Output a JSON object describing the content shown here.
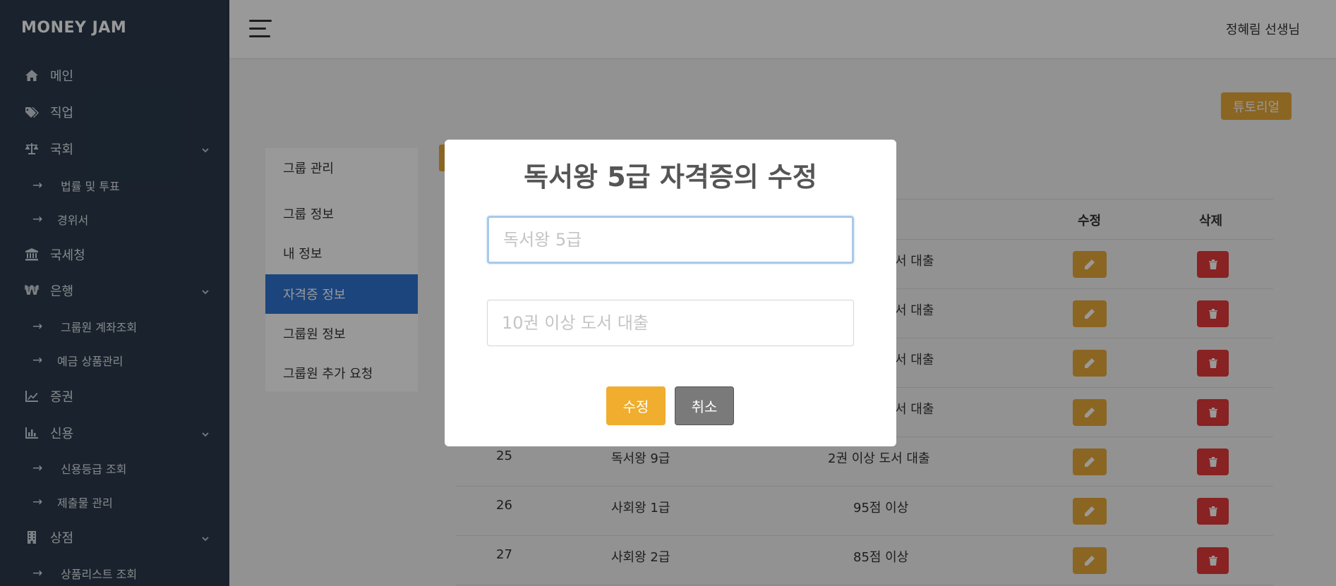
{
  "brand": "MONEY JAM",
  "sidebar": {
    "items": [
      {
        "label": "메인",
        "icon": "home-icon"
      },
      {
        "label": "직업",
        "icon": "tags-icon"
      },
      {
        "label": "국회",
        "icon": "balance-scale-icon",
        "expandable": true
      },
      {
        "label": "법률 및 투표",
        "sub": true
      },
      {
        "label": "경위서",
        "sub": true
      },
      {
        "label": "국세청",
        "icon": "bank-icon"
      },
      {
        "label": "은행",
        "icon": "won-icon",
        "expandable": true
      },
      {
        "label": "그룹원 계좌조회",
        "sub": true
      },
      {
        "label": "예금 상품관리",
        "sub": true
      },
      {
        "label": "증권",
        "icon": "line-chart-icon"
      },
      {
        "label": "신용",
        "icon": "bar-chart-icon",
        "expandable": true
      },
      {
        "label": "신용등급 조회",
        "sub": true
      },
      {
        "label": "제출물 관리",
        "sub": true
      },
      {
        "label": "상점",
        "icon": "building-icon",
        "expandable": true
      },
      {
        "label": "상품리스트 조회",
        "sub": true
      }
    ],
    "arrow": "→"
  },
  "topbar": {
    "user": "정혜림 선생님",
    "tutorial": "튜토리얼"
  },
  "submenu": {
    "header": "그룹 관리",
    "items": [
      "그룹 정보",
      "내 정보",
      "자격증 정보",
      "그룹원 정보",
      "그룹원 추가 요청"
    ],
    "active": "자격증 정보"
  },
  "table": {
    "headers": {
      "edit": "수정",
      "delete": "삭제"
    },
    "partial_rows": [
      "서 대출",
      "서 대출",
      "서 대출",
      "서 대출"
    ],
    "rows": [
      {
        "id": "25",
        "name": "독서왕 9급",
        "condition": "2권 이상 도서 대출"
      },
      {
        "id": "26",
        "name": "사회왕 1급",
        "condition": "95점 이상"
      },
      {
        "id": "27",
        "name": "사회왕 2급",
        "condition": "85점 이상"
      }
    ]
  },
  "modal": {
    "title": "독서왕 5급 자격증의 수정",
    "name_placeholder": "독서왕 5급",
    "condition_placeholder": "10권 이상 도서 대출",
    "save": "수정",
    "cancel": "취소"
  },
  "colors": {
    "sidebar": "#2a3a4b",
    "accent_orange": "#e8a93a",
    "active_blue": "#2f74d0",
    "delete_red": "#e53a3a",
    "cancel_gray": "#7a7a7a"
  }
}
